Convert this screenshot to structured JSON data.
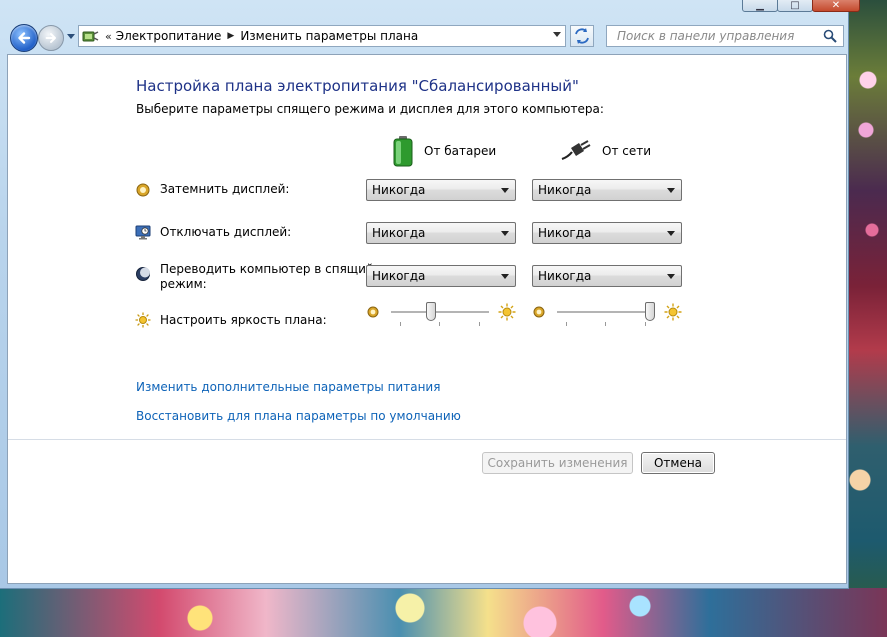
{
  "nav": {
    "breadcrumb": [
      "Электропитание",
      "Изменить параметры плана"
    ],
    "search_placeholder": "Поиск в панели управления"
  },
  "content": {
    "title": "Настройка плана электропитания \"Сбалансированный\"",
    "subtitle": "Выберите параметры спящего режима и дисплея для этого компьютера:",
    "columns": {
      "battery": "От батареи",
      "plugged": "От сети"
    },
    "rows": [
      {
        "label": "Затемнить дисплей:",
        "battery": "Никогда",
        "plugged": "Никогда"
      },
      {
        "label": "Отключать дисплей:",
        "battery": "Никогда",
        "plugged": "Никогда"
      },
      {
        "label_line1": "Переводить компьютер в спящий",
        "label_line2": "режим:",
        "battery": "Никогда",
        "plugged": "Никогда"
      }
    ],
    "brightness": {
      "label": "Настроить яркость плана:",
      "battery_level_pct": 40,
      "plugged_level_pct": 100
    },
    "links": {
      "advanced": "Изменить дополнительные параметры питания",
      "restore": "Восстановить для плана параметры по умолчанию"
    },
    "buttons": {
      "save": "Сохранить изменения",
      "cancel": "Отмена"
    }
  }
}
